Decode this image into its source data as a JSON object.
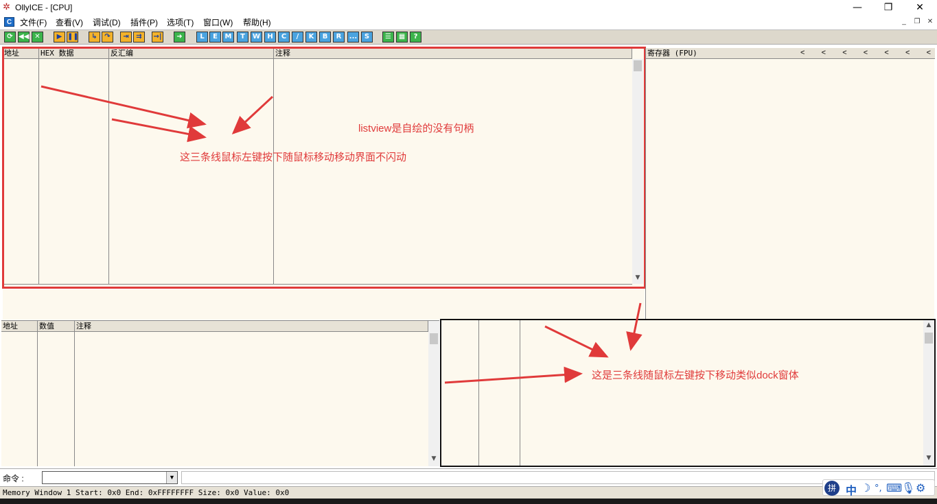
{
  "window": {
    "title": "OllyICE - [CPU]",
    "min_glyph": "—",
    "max_glyph": "❐",
    "close_glyph": "✕"
  },
  "menu": {
    "icon_label": "C",
    "items": [
      "文件(F)",
      "查看(V)",
      "调试(D)",
      "插件(P)",
      "选项(T)",
      "窗口(W)",
      "帮助(H)"
    ],
    "mdi": [
      "_",
      "❐",
      "✕"
    ]
  },
  "toolbar": {
    "buttons": [
      {
        "icon": "restart-icon",
        "glyph": "⟳",
        "color": "g"
      },
      {
        "icon": "rewind-icon",
        "glyph": "◀◀",
        "color": "g"
      },
      {
        "icon": "close-icon",
        "glyph": "✕",
        "color": "g"
      },
      {
        "icon": "run-icon",
        "glyph": "▶",
        "color": "y"
      },
      {
        "icon": "pause-icon",
        "glyph": "❚❚",
        "color": "y"
      },
      {
        "icon": "step-into-icon",
        "glyph": "↳",
        "color": "y"
      },
      {
        "icon": "step-over-icon",
        "glyph": "↷",
        "color": "y"
      },
      {
        "icon": "trace-into-icon",
        "glyph": "⇥",
        "color": "y"
      },
      {
        "icon": "trace-over-icon",
        "glyph": "⇉",
        "color": "y"
      },
      {
        "icon": "execute-till-return-icon",
        "glyph": "→|",
        "color": "y"
      },
      {
        "icon": "goto-icon",
        "glyph": "➜",
        "color": "g"
      },
      {
        "icon": "L-icon",
        "glyph": "L",
        "color": "b"
      },
      {
        "icon": "E-icon",
        "glyph": "E",
        "color": "b"
      },
      {
        "icon": "M-icon",
        "glyph": "M",
        "color": "b"
      },
      {
        "icon": "T-icon",
        "glyph": "T",
        "color": "b"
      },
      {
        "icon": "W-icon",
        "glyph": "W",
        "color": "b"
      },
      {
        "icon": "H-icon",
        "glyph": "H",
        "color": "b"
      },
      {
        "icon": "C-icon",
        "glyph": "C",
        "color": "b"
      },
      {
        "icon": "slash-icon",
        "glyph": "/",
        "color": "b"
      },
      {
        "icon": "K-icon",
        "glyph": "K",
        "color": "b"
      },
      {
        "icon": "B-icon",
        "glyph": "B",
        "color": "b"
      },
      {
        "icon": "R-icon",
        "glyph": "R",
        "color": "b"
      },
      {
        "icon": "ellipsis-icon",
        "glyph": "...",
        "color": "b"
      },
      {
        "icon": "S-icon",
        "glyph": "S",
        "color": "b"
      },
      {
        "icon": "list-icon",
        "glyph": "☰",
        "color": "g"
      },
      {
        "icon": "grid-icon",
        "glyph": "▦",
        "color": "g"
      },
      {
        "icon": "help-icon",
        "glyph": "?",
        "color": "g"
      }
    ]
  },
  "disasm": {
    "columns": [
      "地址",
      "HEX 数据",
      "反汇编",
      "注释"
    ]
  },
  "registers": {
    "header": "寄存器 (FPU)",
    "chevrons": [
      "<",
      "<",
      "<",
      "<",
      "<",
      "<",
      "<"
    ]
  },
  "dump": {
    "columns": [
      "地址",
      "数值",
      "注释"
    ]
  },
  "annotations": {
    "listview_note": "listview是自绘的没有句柄",
    "lines_note": "这三条线鼠标左键按下随鼠标移动移动界面不闪动",
    "dock_note": "这是三条线随鼠标左键按下移动类似dock窗体"
  },
  "command": {
    "label": "命令 :",
    "value": ""
  },
  "status": {
    "text": "Memory Window 1  Start: 0x0  End: 0xFFFFFFFF  Size: 0x0 Value: 0x0"
  },
  "ime": {
    "zh_label": "中",
    "logo_label": "拼"
  },
  "colors": {
    "pane_bg": "#fdf9ee",
    "highlight_red": "#e03a3a"
  }
}
